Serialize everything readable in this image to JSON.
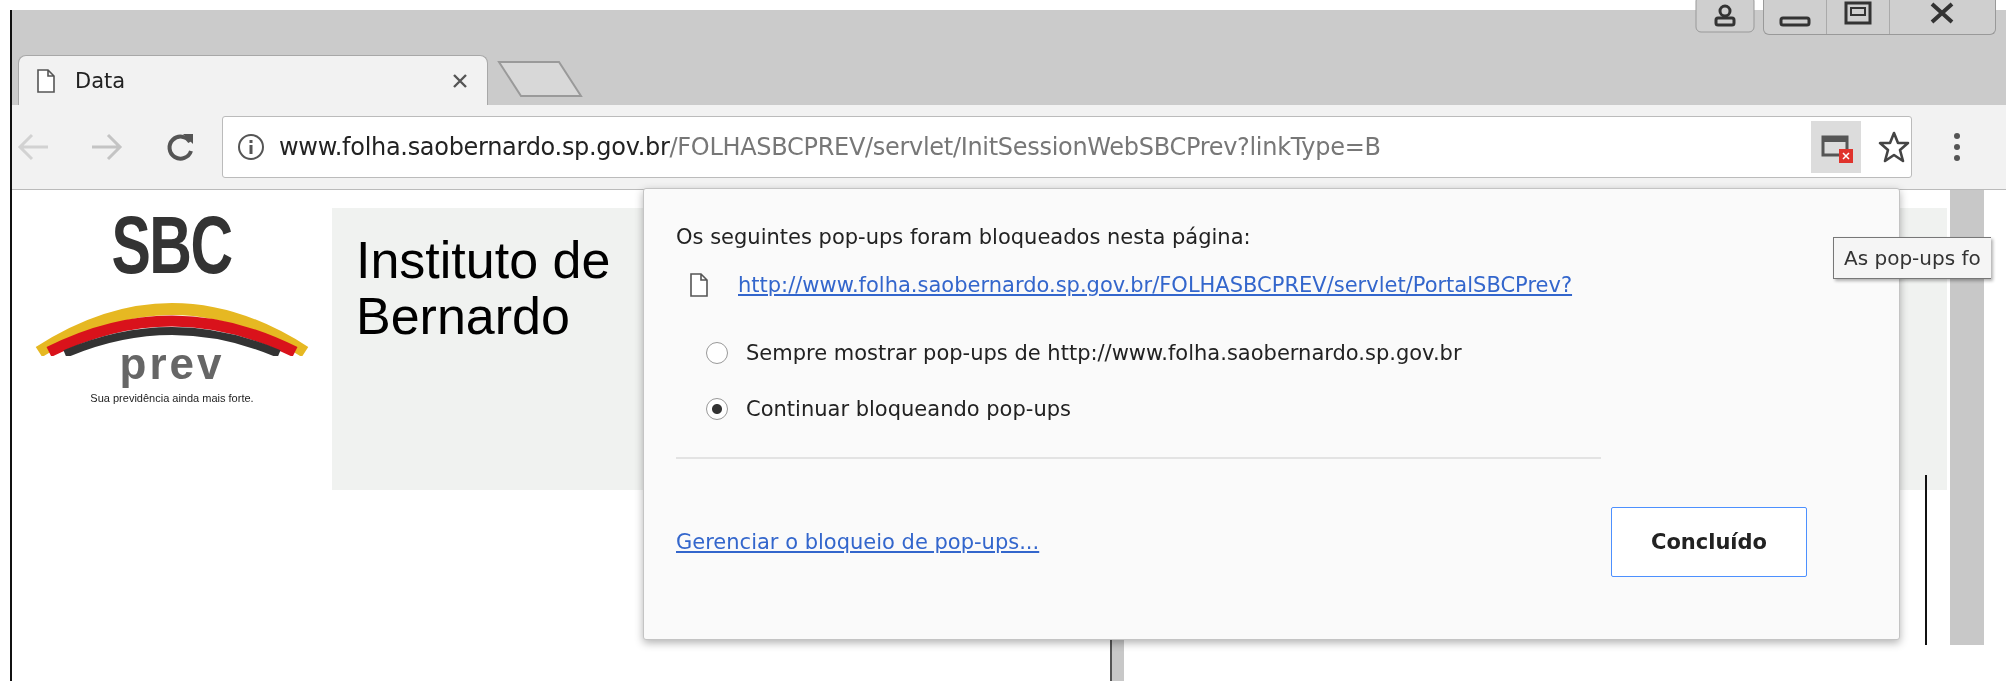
{
  "tabs": [
    {
      "title": "Data",
      "selected": true
    }
  ],
  "address_bar": {
    "host": "www.folha.saobernardo.sp.gov.br",
    "path": "/FOLHASBCPREV/servlet/InitSessionWebSBCPrev?linkType=B",
    "popup_blocked": true
  },
  "logo": {
    "name": "SBC",
    "sub": "prev",
    "tagline": "Sua previdência ainda mais forte."
  },
  "page_title": [
    "Instituto de",
    "Bernardo"
  ],
  "popup": {
    "heading": "Os seguintes pop-ups foram bloqueados nesta página:",
    "blocked_links": [
      "http://www.folha.saobernardo.sp.gov.br/FOLHASBCPREV/servlet/PortalSBCPrev?"
    ],
    "options": [
      {
        "label": "Sempre mostrar pop-ups de http://www.folha.saobernardo.sp.gov.br",
        "selected": false
      },
      {
        "label": "Continuar bloqueando pop-ups",
        "selected": true
      }
    ],
    "manage_link": "Gerenciar o bloqueio de pop-ups...",
    "done_button": "Concluído"
  },
  "tooltip": "As pop-ups fo"
}
